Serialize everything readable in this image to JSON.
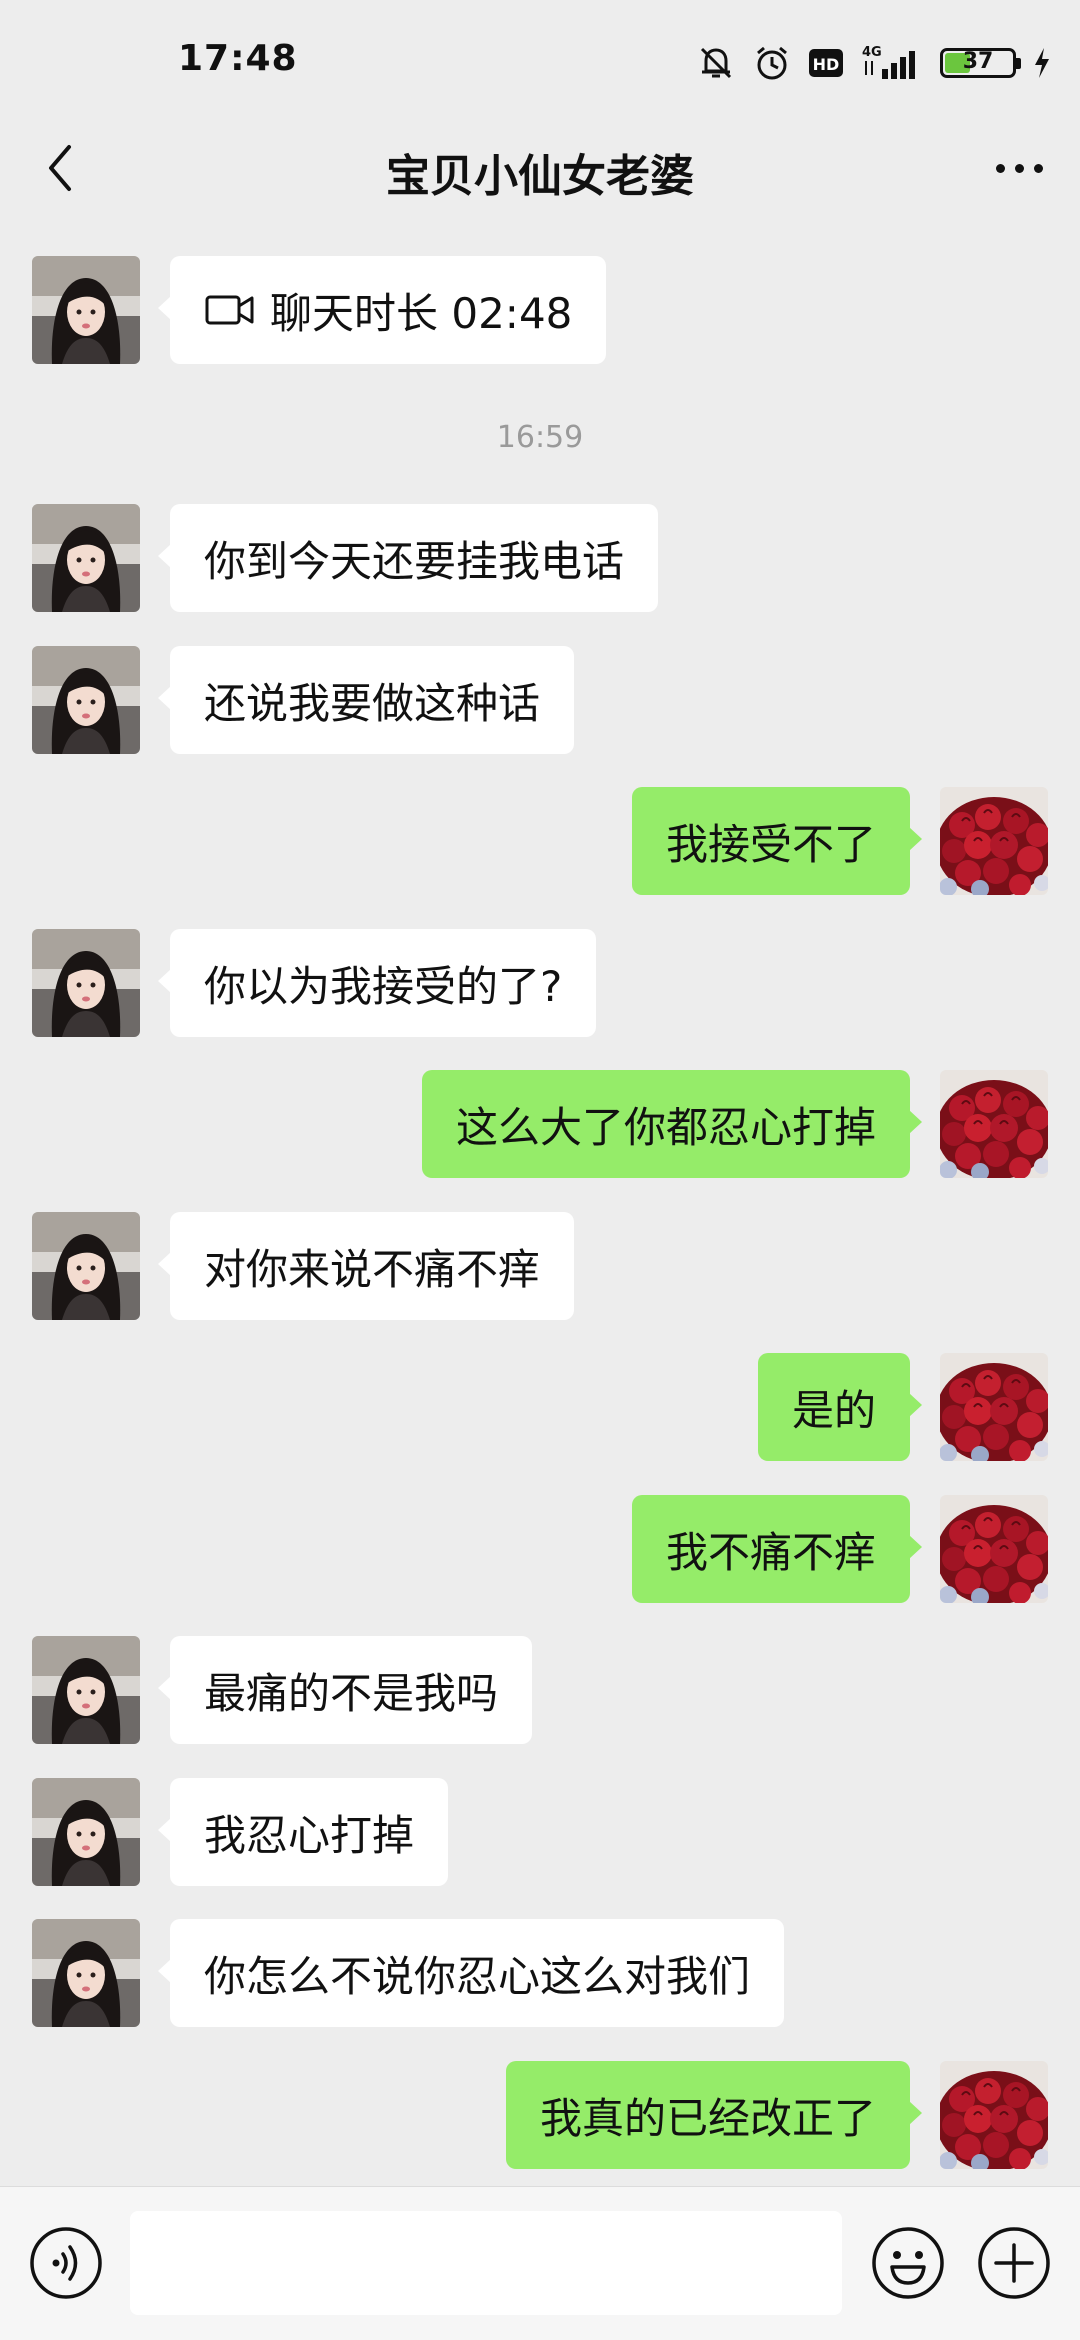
{
  "status_bar": {
    "time": "17:48",
    "network": "4G",
    "hd": "HD",
    "battery_level": "37",
    "battery_fraction": 0.37,
    "icons": [
      "mute-icon",
      "alarm-icon",
      "hd-icon",
      "signal-icon",
      "battery-icon",
      "charging-icon"
    ]
  },
  "header": {
    "title": "宝贝小仙女老婆",
    "back_icon": "chevron-left-icon",
    "more_icon": "more-dots-icon"
  },
  "chat": {
    "call_record": {
      "label": "聊天时长 02:48",
      "icon": "video-call-icon",
      "side": "left"
    },
    "timestamp": "16:59",
    "messages": [
      {
        "side": "left",
        "text": "你到今天还要挂我电话"
      },
      {
        "side": "left",
        "text": "还说我要做这种话"
      },
      {
        "side": "right",
        "text": "我接受不了"
      },
      {
        "side": "left",
        "text": "你以为我接受的了?"
      },
      {
        "side": "right",
        "text": "这么大了你都忍心打掉"
      },
      {
        "side": "left",
        "text": "对你来说不痛不痒"
      },
      {
        "side": "right",
        "text": "是的"
      },
      {
        "side": "right",
        "text": "我不痛不痒"
      },
      {
        "side": "left",
        "text": "最痛的不是我吗"
      },
      {
        "side": "left",
        "text": "我忍心打掉"
      },
      {
        "side": "left",
        "text": "你怎么不说你忍心这么对我们"
      },
      {
        "side": "right",
        "text": "我真的已经改正了"
      }
    ]
  },
  "input_bar": {
    "value": "",
    "voice_icon": "voice-icon",
    "emoji_icon": "emoji-icon",
    "plus_icon": "plus-icon"
  },
  "colors": {
    "background": "#ededed",
    "sent_bubble": "#95ec69",
    "received_bubble": "#ffffff"
  }
}
